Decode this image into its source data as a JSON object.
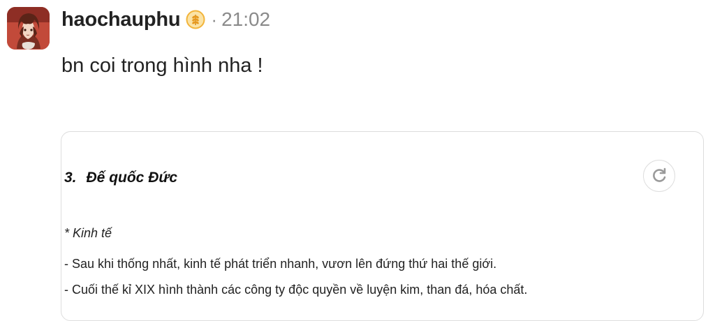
{
  "post": {
    "username": "haochauphu",
    "separator": "·",
    "time": "21:02",
    "message": "bn coi trong hình nha !",
    "avatar_icon": "anime-avatar",
    "badge_icon": "wheat-badge-icon"
  },
  "attachment": {
    "heading_number": "3.",
    "heading_text": "Đế quốc Đức",
    "lines": [
      "* Kinh tế",
      "- Sau khi thống nhất, kinh tế phát triển nhanh, vươn lên đứng thứ hai thế giới.",
      "- Cuối thế kỉ XIX hình thành các công ty độc quyền về luyện kim, than đá, hóa chất."
    ],
    "refresh_icon": "refresh-icon"
  },
  "colors": {
    "username": "#222222",
    "meta": "#8a8a8a",
    "badge": "#f2b43a",
    "card_border": "#dddddd"
  }
}
